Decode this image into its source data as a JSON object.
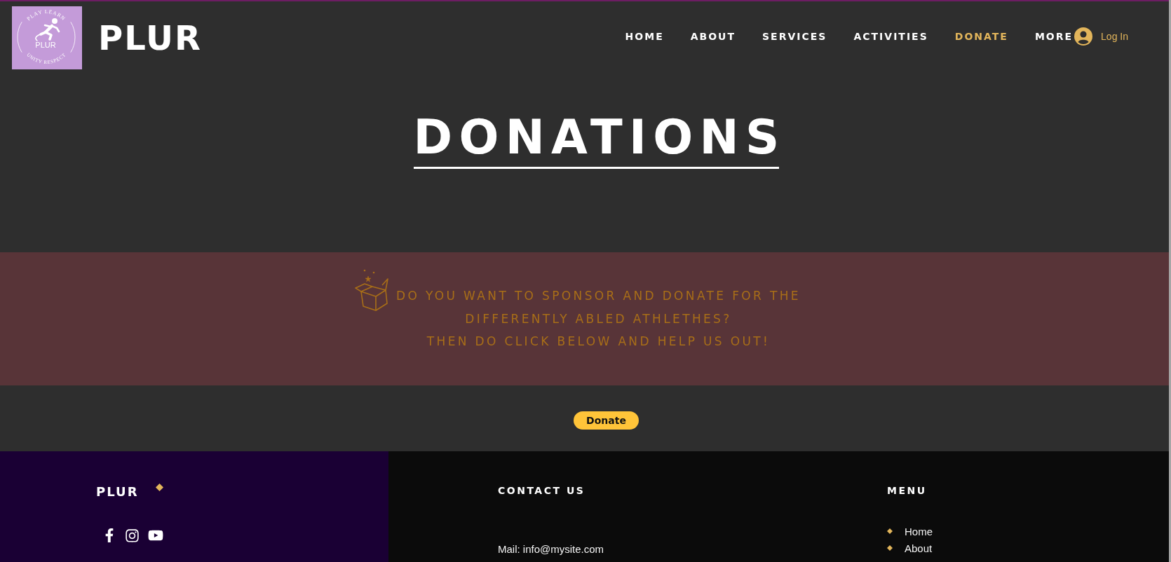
{
  "header": {
    "logo": {
      "arc_top": "PLAY LEARN",
      "center": "PLUR",
      "arc_bottom": "UNITY RESPECT"
    },
    "site_name": "PLUR",
    "nav": [
      {
        "label": "HOME",
        "selected": false
      },
      {
        "label": "ABOUT",
        "selected": false
      },
      {
        "label": "SERVICES",
        "selected": false
      },
      {
        "label": "ACTIVITIES",
        "selected": false
      },
      {
        "label": "DONATE",
        "selected": true
      },
      {
        "label": "MORE",
        "selected": false
      }
    ],
    "login": "Log In"
  },
  "hero": {
    "title": "DONATIONS"
  },
  "banner": {
    "lines": [
      "DO YOU WANT TO SPONSOR AND DONATE FOR THE",
      "DIFFERENTLY ABLED ATHLETHES?",
      "THEN DO CLICK BELOW AND HELP US OUT!"
    ]
  },
  "donate_button": "Donate",
  "footer": {
    "brand": "PLUR",
    "contact": {
      "heading": "CONTACT US",
      "lines": [
        "Mail: info@mysite.com"
      ]
    },
    "menu": {
      "heading": "MENU",
      "items": [
        "Home",
        "About"
      ]
    }
  }
}
